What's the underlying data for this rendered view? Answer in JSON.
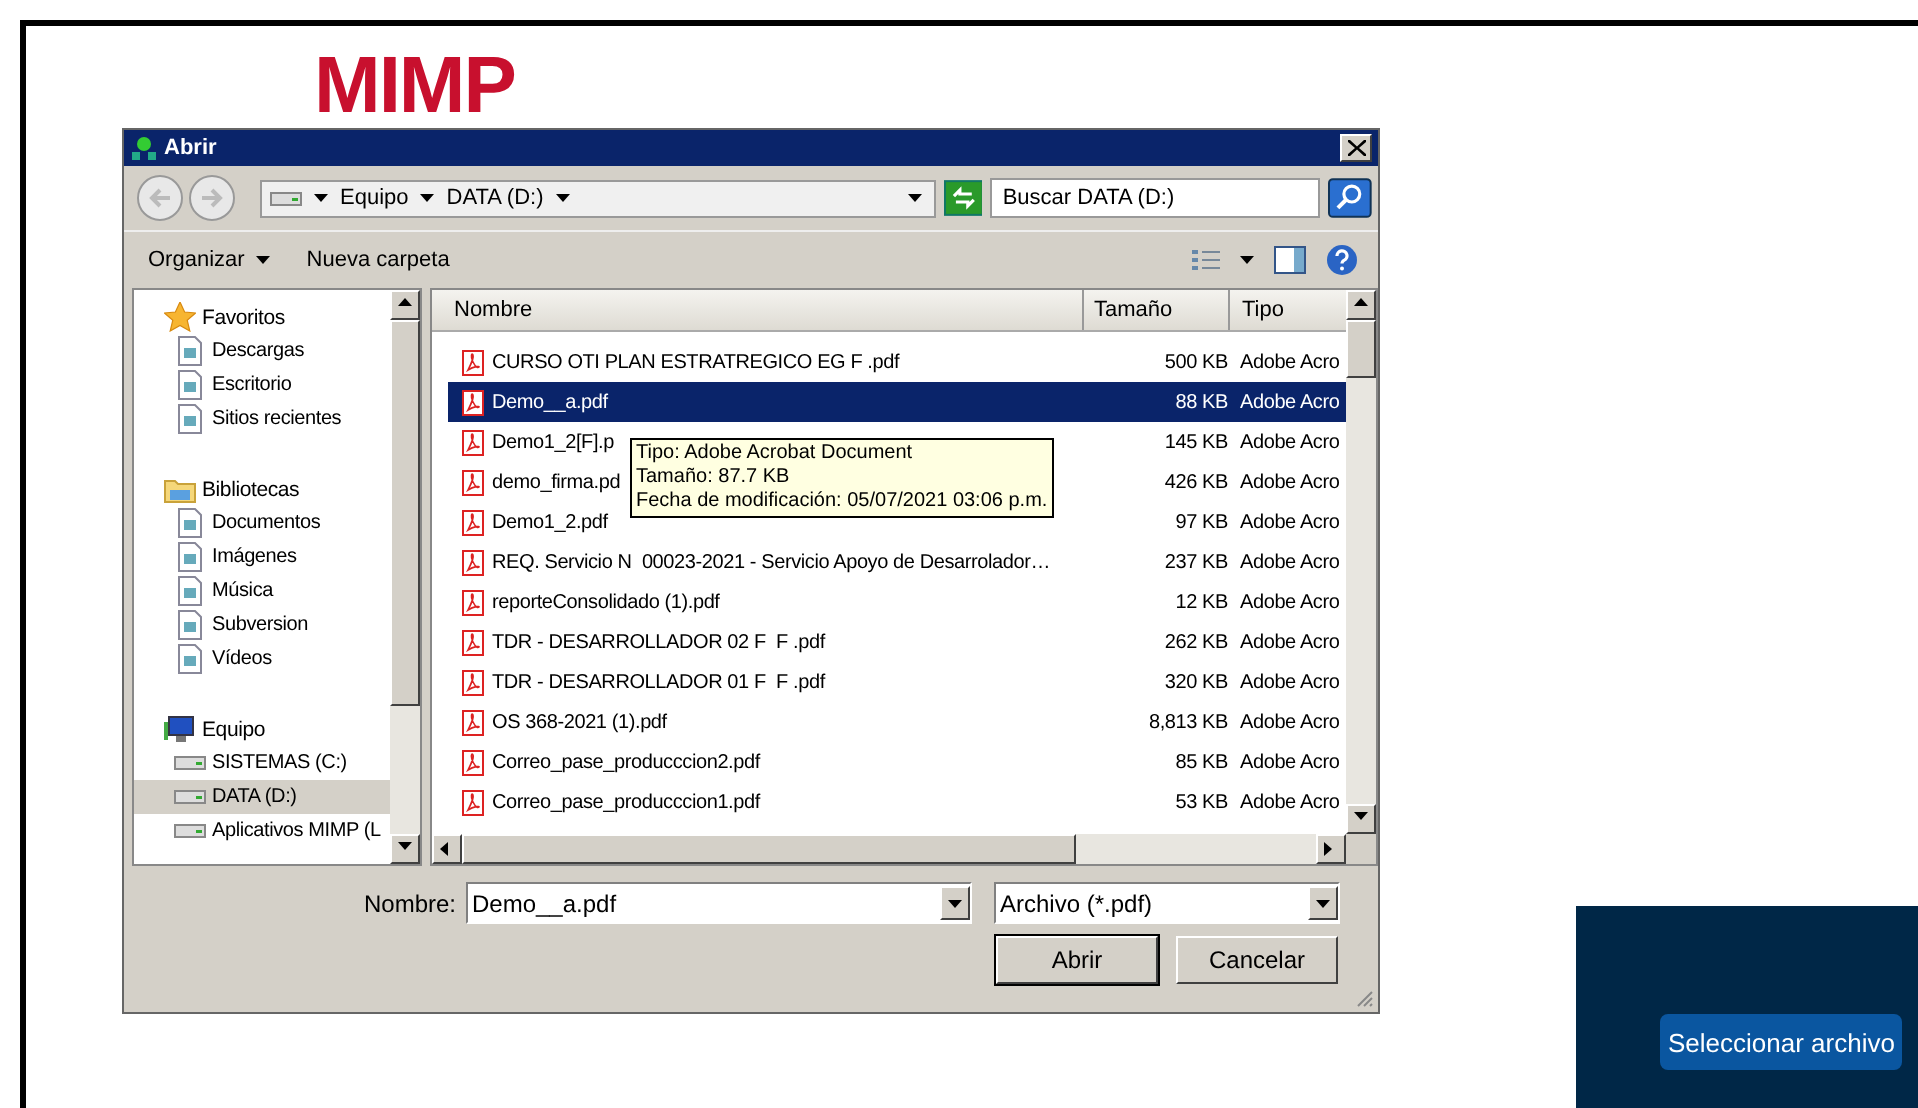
{
  "page": {
    "logo": "MIMP",
    "select_button": "Seleccionar archivo"
  },
  "window": {
    "title": "Abrir"
  },
  "address": {
    "crumbs": [
      "Equipo",
      "DATA (D:)"
    ]
  },
  "search": {
    "placeholder": "Buscar DATA (D:)"
  },
  "toolbar": {
    "organize": "Organizar",
    "new_folder": "Nueva carpeta"
  },
  "sidebar": {
    "groups": [
      {
        "label": "Favoritos",
        "selected": false,
        "children": [
          {
            "label": "Descargas",
            "selected": false
          },
          {
            "label": "Escritorio",
            "selected": false
          },
          {
            "label": "Sitios recientes",
            "selected": false
          }
        ]
      },
      {
        "label": "Bibliotecas",
        "selected": false,
        "children": [
          {
            "label": "Documentos",
            "selected": false
          },
          {
            "label": "Imágenes",
            "selected": false
          },
          {
            "label": "Música",
            "selected": false
          },
          {
            "label": "Subversion",
            "selected": false
          },
          {
            "label": "Vídeos",
            "selected": false
          }
        ]
      },
      {
        "label": "Equipo",
        "selected": false,
        "children": [
          {
            "label": "SISTEMAS (C:)",
            "selected": false
          },
          {
            "label": "DATA (D:)",
            "selected": true
          },
          {
            "label": "Aplicativos MIMP (L",
            "selected": false
          }
        ]
      }
    ]
  },
  "table": {
    "columns": [
      "Nombre",
      "Tamaño",
      "Tipo"
    ],
    "rows": [
      {
        "name": "CURSO OTI PLAN ESTRATREGICO EG F .pdf",
        "size": "500 KB",
        "type": "Adobe Acro",
        "selected": false
      },
      {
        "name": "Demo__a.pdf",
        "size": "88 KB",
        "type": "Adobe Acro",
        "selected": true
      },
      {
        "name": "Demo1_2[F].p",
        "size": "145 KB",
        "type": "Adobe Acro",
        "selected": false
      },
      {
        "name": "demo_firma.pd",
        "size": "426 KB",
        "type": "Adobe Acro",
        "selected": false
      },
      {
        "name": "Demo1_2.pdf",
        "size": "97 KB",
        "type": "Adobe Acro",
        "selected": false
      },
      {
        "name": "REQ. Servicio N  00023-2021 - Servicio Apoyo de Desarrolador…",
        "size": "237 KB",
        "type": "Adobe Acro",
        "selected": false
      },
      {
        "name": "reporteConsolidado (1).pdf",
        "size": "12 KB",
        "type": "Adobe Acro",
        "selected": false
      },
      {
        "name": "TDR - DESARROLLADOR 02 F  F .pdf",
        "size": "262 KB",
        "type": "Adobe Acro",
        "selected": false
      },
      {
        "name": "TDR - DESARROLLADOR 01 F  F .pdf",
        "size": "320 KB",
        "type": "Adobe Acro",
        "selected": false
      },
      {
        "name": "OS 368-2021 (1).pdf",
        "size": "8,813 KB",
        "type": "Adobe Acro",
        "selected": false
      },
      {
        "name": "Correo_pase_producccion2.pdf",
        "size": "85 KB",
        "type": "Adobe Acro",
        "selected": false
      },
      {
        "name": "Correo_pase_producccion1.pdf",
        "size": "53 KB",
        "type": "Adobe Acro",
        "selected": false
      }
    ]
  },
  "tooltip": {
    "lines": [
      "Tipo: Adobe Acrobat Document",
      "Tamaño: 87.7 KB",
      "Fecha de modificación: 05/07/2021 03:06 p.m."
    ]
  },
  "footer": {
    "name_label": "Nombre:",
    "name_value": "Demo__a.pdf",
    "filter": "Archivo (*.pdf)",
    "buttons": [
      "Abrir",
      "Cancelar"
    ]
  }
}
